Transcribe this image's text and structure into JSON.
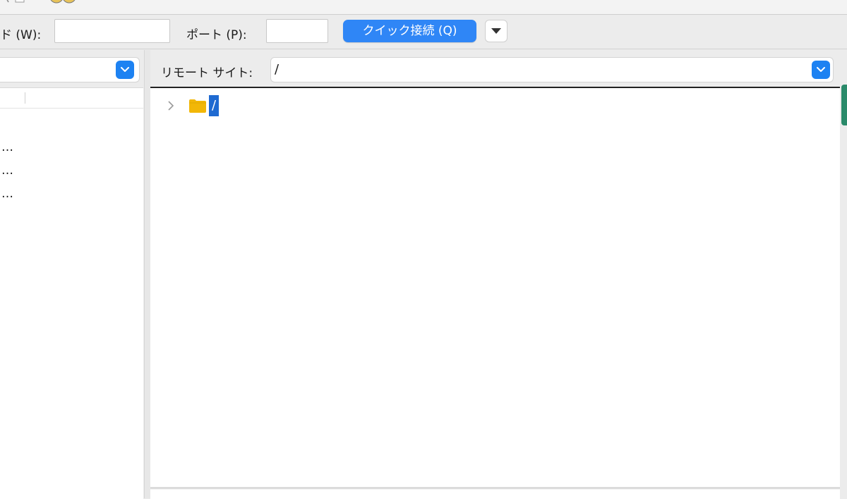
{
  "colors": {
    "accent": "#2f86f6",
    "selection": "#1f6ad1",
    "folder": "#f2b707"
  },
  "quickconnect": {
    "password_label": "ド (W):",
    "port_label": "ポート (P):",
    "connect_button": "クイック接続 (Q)",
    "password_value": "",
    "port_value": ""
  },
  "local": {
    "rows": [
      "…",
      "…",
      "…"
    ]
  },
  "remote": {
    "site_label": "リモート サイト:",
    "path": "/",
    "tree": [
      {
        "name": "/",
        "icon": "folder-icon",
        "expander": "chevron-right-icon"
      }
    ]
  }
}
